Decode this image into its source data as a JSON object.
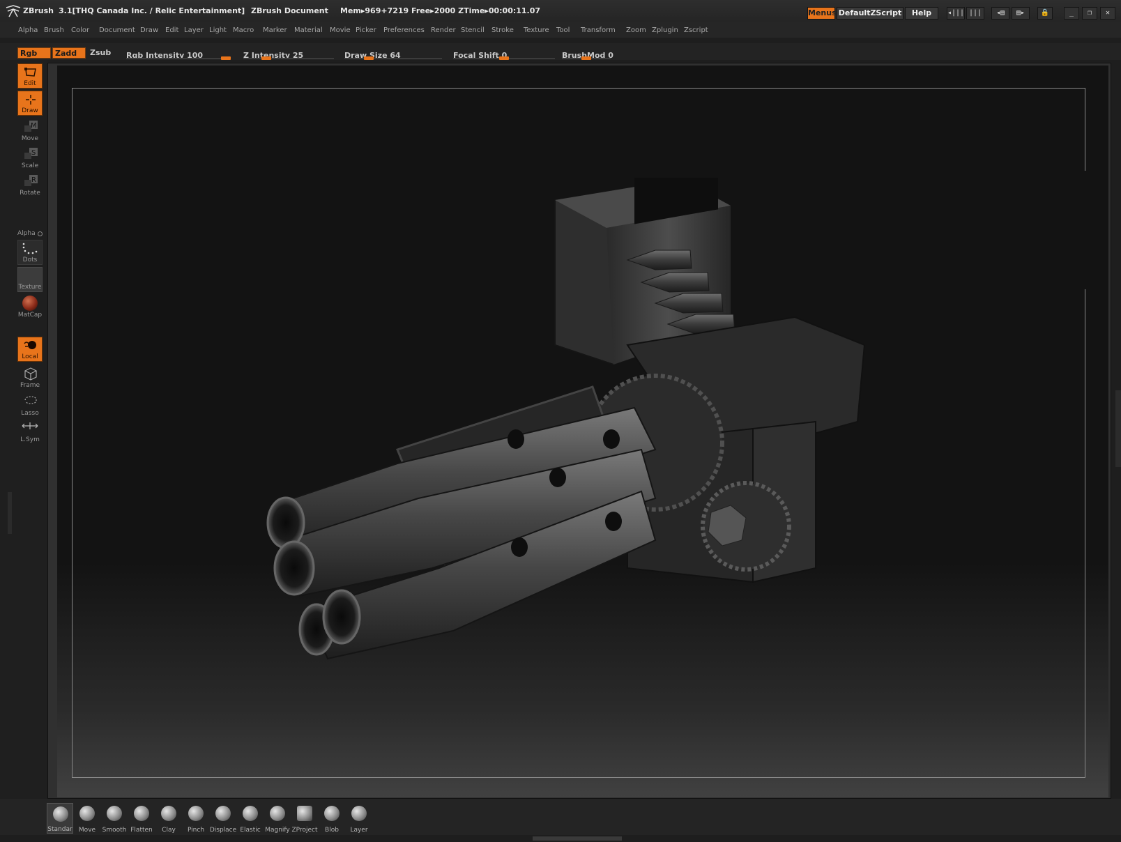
{
  "titlebar": {
    "app": "ZBrush",
    "version": "3.1[THQ Canada Inc. / Relic Entertainment]",
    "document": "ZBrush Document",
    "status": "Mem▸969+7219  Free▸2000  ZTime▸00:00:11.07",
    "buttons": {
      "menus": "Menus",
      "script": "DefaultZScript",
      "help": "Help"
    }
  },
  "menubar": {
    "items": [
      "Alpha",
      "Brush",
      "Color",
      "Document",
      "Draw",
      "Edit",
      "Layer",
      "Light",
      "Macro",
      "Marker",
      "Material",
      "Movie",
      "Picker",
      "Preferences",
      "Render",
      "Stencil",
      "Stroke",
      "Texture",
      "Tool",
      "Transform",
      "Zoom",
      "Zplugin",
      "Zscript"
    ]
  },
  "shelf": {
    "rgb": "Rgb",
    "zadd": "Zadd",
    "zsub": "Zsub",
    "rgb_intensity": {
      "label": "Rgb  Intensity 100",
      "value": 100,
      "max": 100
    },
    "z_intensity": {
      "label": "Z  Intensity 25",
      "value": 25,
      "max": 100
    },
    "draw_size": {
      "label": "Draw  Size 64",
      "value": 64,
      "max": 256
    },
    "focal_shift": {
      "label": "Focal  Shift 0",
      "value": 0,
      "min": -100,
      "max": 100
    },
    "brushmod": {
      "label": "BrushMod 0",
      "value": 0,
      "min": -100,
      "max": 100
    }
  },
  "tools": {
    "edit": "Edit",
    "draw": "Draw",
    "move": "Move",
    "scale": "Scale",
    "rotate": "Rotate",
    "alpha": "Alpha",
    "dots": "Dots",
    "texture": "Texture",
    "matcap": "MatCap",
    "local": "Local",
    "frame": "Frame",
    "lasso": "Lasso",
    "lsym": "L.Sym"
  },
  "brushes": [
    "Standar",
    "Move",
    "Smooth",
    "Flatten",
    "Clay",
    "Pinch",
    "Displace",
    "Elastic",
    "Magnify",
    "ZProject",
    "Blob",
    "Layer"
  ],
  "colors": {
    "accent": "#e8741b",
    "background": "#1e1e1e",
    "canvas": "#131313"
  },
  "icons": [
    "zbrush-logo-icon",
    "edit-icon",
    "draw-icon",
    "move-icon",
    "scale-icon",
    "rotate-icon",
    "dots-alpha-icon",
    "matcap-sphere-icon",
    "local-icon",
    "frame-cube-icon",
    "lasso-icon",
    "lsym-icon"
  ]
}
